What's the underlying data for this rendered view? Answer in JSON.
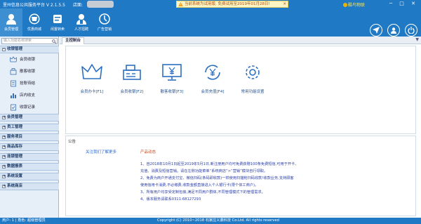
{
  "window": {
    "title": "里州信息公共服务平台 V 2.1.5.5",
    "store_label": "店面:",
    "notice": "当前系统为试用版, 免费试用至2019年01月28日!",
    "notice_close": "✕",
    "user_label": "酷鸟物联",
    "controls": "─ □ ✕"
  },
  "nav": [
    {
      "label": "会员管理",
      "icon": "member-management-icon",
      "active": true
    },
    {
      "label": "优惠商城",
      "icon": "shopping-mall-icon",
      "active": false
    },
    {
      "label": "闲置转卖",
      "icon": "idle-resale-icon",
      "active": false
    },
    {
      "label": "人才招聘",
      "icon": "recruitment-icon",
      "active": false
    },
    {
      "label": "广告营销",
      "icon": "ad-marketing-icon",
      "active": false
    }
  ],
  "toolbar_icons": [
    "send-icon",
    "user-icon",
    "power-icon"
  ],
  "sidebar": {
    "search_placeholder": "输入功能名称搜索",
    "groups": [
      {
        "label": "收银管理",
        "expanded": true,
        "sign": "-"
      },
      {
        "label": "会员管理",
        "expanded": false,
        "sign": "+"
      },
      {
        "label": "员工管理",
        "expanded": false,
        "sign": "+"
      },
      {
        "label": "服务项目",
        "expanded": false,
        "sign": "+"
      },
      {
        "label": "商品库存",
        "expanded": false,
        "sign": "+"
      },
      {
        "label": "连锁管理",
        "expanded": false,
        "sign": "+"
      },
      {
        "label": "数据报表",
        "expanded": false,
        "sign": "+"
      },
      {
        "label": "系统设置",
        "expanded": false,
        "sign": "+"
      },
      {
        "label": "系统商店",
        "expanded": false,
        "sign": "+"
      }
    ],
    "sub_items": [
      {
        "label": "会员收银",
        "icon": "crown-icon"
      },
      {
        "label": "散客收银",
        "icon": "pos-icon"
      },
      {
        "label": "挂账待结",
        "icon": "hanging-bill-icon"
      },
      {
        "label": "店内收支",
        "icon": "chart-icon"
      },
      {
        "label": "收银记录",
        "icon": "record-icon"
      }
    ]
  },
  "main": {
    "tab": "主控制台",
    "tab_menu": "▼",
    "quick_actions": [
      {
        "label": "会员办卡[F1]",
        "icon": "crown-icon"
      },
      {
        "label": "会员收银[F2]",
        "icon": "cash-register-icon"
      },
      {
        "label": "散客收银[F3]",
        "icon": "monitor-yen-icon"
      },
      {
        "label": "会员充值[F4]",
        "icon": "recharge-icon"
      },
      {
        "label": "常用功能设置",
        "icon": "settings-gear-icon"
      }
    ],
    "announcement": {
      "header": "公告",
      "qr_link": "关注我们了解更多",
      "news_title": "产品动态",
      "lines": [
        "1、自2018年10月1日起至2019年5月1日,新注册用户均可免费获赠100条免费短信,可用于开卡、",
        "   充值、消费及短信营销。请在左侧功能菜单“系统商店”>“营销”模块自行领取。",
        "2、免费为商户开通支付宝、微信扫码(条码即收款)一样使用扫描枪扫码收款!收款业务,支持顾客",
        "   使用信用卡消费,不必缴费,收款金额直接进入个人银行卡(限个体工商户)。",
        "3、所有用户均享受定制包装,满足不同用户群体,不同管理模式下的管理需求。",
        "4、版本服务请联系0311-68127293"
      ]
    }
  },
  "status": {
    "left": "用户: 1     |   角色: 超级管理员",
    "copyright": "Copyright (C) 2010~2018 石家庄义鼎科技 Co.Ltd. All rights reserved"
  }
}
